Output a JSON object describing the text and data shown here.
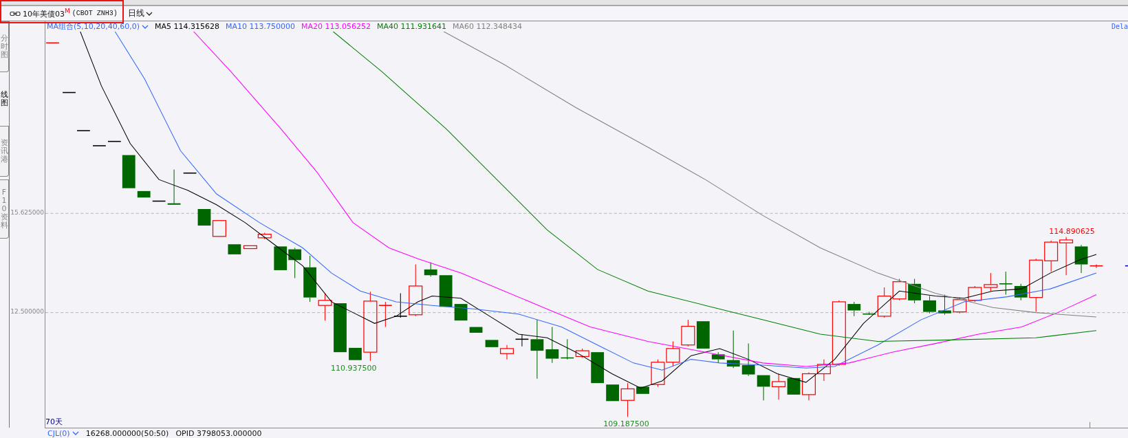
{
  "window": {
    "title": "10年美债03$^{M}$",
    "contract": "(CBOT ZNH3)",
    "period": "日线"
  },
  "side_tabs": [
    {
      "label": "分时图",
      "selected": false
    },
    {
      "label": "线图",
      "selected": true
    },
    {
      "label": "资讯港",
      "selected": false
    },
    {
      "label": "F10资料",
      "selected": false
    }
  ],
  "indicator": {
    "name": "MA组合(5,10,20,40,60,0)",
    "lines": [
      {
        "label": "MA5",
        "value": "114.315628",
        "color": "#000000"
      },
      {
        "label": "MA10",
        "value": "113.750000",
        "color": "#3366ff"
      },
      {
        "label": "MA20",
        "value": "113.056252",
        "color": "#ff00ff"
      },
      {
        "label": "MA40",
        "value": "111.931641",
        "color": "#008000"
      },
      {
        "label": "MA60",
        "value": "112.348434",
        "color": "#808080"
      }
    ]
  },
  "delay_tag": "Dela",
  "chart": {
    "yticks": [
      "15.625000",
      "12.500000"
    ],
    "annotations": [
      {
        "text": "114.890625",
        "kind": "high"
      },
      {
        "text": "110.937500",
        "kind": "low"
      },
      {
        "text": "109.187500",
        "kind": "low"
      }
    ],
    "range_label": "70天"
  },
  "volume_bar": {
    "indicator": "CJL(0)",
    "volume": "16268.000000(50:50)",
    "opid": "OPID 3798053.000000"
  }
}
